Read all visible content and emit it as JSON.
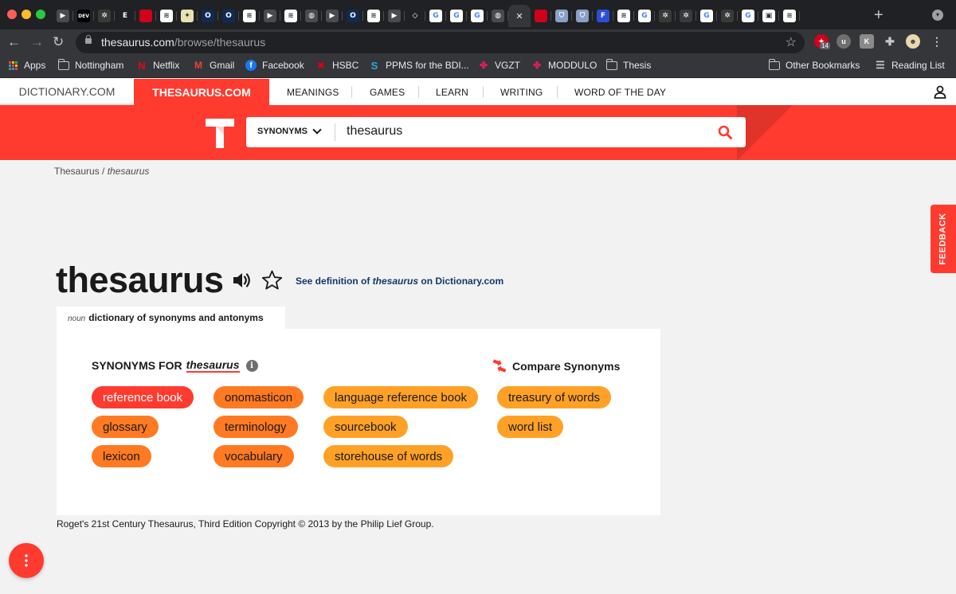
{
  "browser": {
    "tabs": [
      {
        "icon": "play-icon",
        "color": "#4a4b4f",
        "glyph": "▶"
      },
      {
        "icon": "dev-icon",
        "color": "#000000",
        "glyph": "DEV"
      },
      {
        "icon": "pinwheel-icon",
        "color": "#3a3a3a",
        "glyph": "✲"
      },
      {
        "icon": "e-icon",
        "color": "#202124",
        "glyph": "E"
      },
      {
        "icon": "red-square-icon",
        "color": "#d0021b",
        "glyph": ""
      },
      {
        "icon": "doc-icon",
        "color": "#ffffff",
        "glyph": "≋"
      },
      {
        "icon": "bird-icon",
        "color": "#e8e2b0",
        "glyph": "✦"
      },
      {
        "icon": "outlook-icon",
        "color": "#0f2b55",
        "glyph": "O"
      },
      {
        "icon": "outlook-icon",
        "color": "#0f2b55",
        "glyph": "O"
      },
      {
        "icon": "doc-icon",
        "color": "#ffffff",
        "glyph": "≋"
      },
      {
        "icon": "play-icon",
        "color": "#4a4b4f",
        "glyph": "▶"
      },
      {
        "icon": "doc-icon",
        "color": "#ffffff",
        "glyph": "≋"
      },
      {
        "icon": "globe-icon",
        "color": "#4a4b4f",
        "glyph": "◍"
      },
      {
        "icon": "play-icon",
        "color": "#4a4b4f",
        "glyph": "▶"
      },
      {
        "icon": "outlook-icon",
        "color": "#0f2b55",
        "glyph": "O"
      },
      {
        "icon": "doc-icon",
        "color": "#ffffff",
        "glyph": "≋"
      },
      {
        "icon": "play-icon",
        "color": "#4a4b4f",
        "glyph": "▶"
      },
      {
        "icon": "diamond-icon",
        "color": "#202124",
        "glyph": "◇"
      },
      {
        "icon": "google-icon",
        "color": "#ffffff",
        "glyph": "G"
      },
      {
        "icon": "google-icon",
        "color": "#ffffff",
        "glyph": "G"
      },
      {
        "icon": "google-icon",
        "color": "#ffffff",
        "glyph": "G"
      },
      {
        "icon": "globe-icon",
        "color": "#4a4b4f",
        "glyph": "◍"
      },
      {
        "icon": "close-icon",
        "color": "#35363a",
        "glyph": "✕",
        "active": true
      },
      {
        "icon": "red-square-icon",
        "color": "#d0021b",
        "glyph": ""
      },
      {
        "icon": "shield-icon",
        "color": "#8aa0c8",
        "glyph": "⛉"
      },
      {
        "icon": "shield-icon",
        "color": "#8aa0c8",
        "glyph": "⛉"
      },
      {
        "icon": "f-icon",
        "color": "#2b4fd8",
        "glyph": "F"
      },
      {
        "icon": "doc-icon",
        "color": "#ffffff",
        "glyph": "≋"
      },
      {
        "icon": "google-icon",
        "color": "#ffffff",
        "glyph": "G"
      },
      {
        "icon": "pinwheel-icon",
        "color": "#3a3a3a",
        "glyph": "✲"
      },
      {
        "icon": "pinwheel-icon",
        "color": "#3a3a3a",
        "glyph": "✲"
      },
      {
        "icon": "google-icon",
        "color": "#ffffff",
        "glyph": "G"
      },
      {
        "icon": "pinwheel-icon",
        "color": "#3a3a3a",
        "glyph": "✲"
      },
      {
        "icon": "google-icon",
        "color": "#ffffff",
        "glyph": "G"
      },
      {
        "icon": "lock-icon",
        "color": "#ffffff",
        "glyph": "▣"
      },
      {
        "icon": "doc-icon",
        "color": "#ffffff",
        "glyph": "≋"
      }
    ],
    "new_tab": "+",
    "url_host": "thesaurus.com",
    "url_path": "/browse/thesaurus",
    "extension_badge": "14",
    "bookmarks": [
      {
        "label": "Apps",
        "icon": "apps-icon"
      },
      {
        "label": "Nottingham",
        "icon": "folder-icon"
      },
      {
        "label": "Netflix",
        "icon": "netflix-icon"
      },
      {
        "label": "Gmail",
        "icon": "gmail-icon"
      },
      {
        "label": "Facebook",
        "icon": "facebook-icon"
      },
      {
        "label": "HSBC",
        "icon": "hsbc-icon"
      },
      {
        "label": "PPMS for the BDI...",
        "icon": "ppms-icon"
      },
      {
        "label": "VGZT",
        "icon": "slack-icon"
      },
      {
        "label": "MODDULO",
        "icon": "slack-icon"
      },
      {
        "label": "Thesis",
        "icon": "folder-icon"
      }
    ],
    "other_bookmarks": "Other Bookmarks",
    "reading_list": "Reading List"
  },
  "site": {
    "nav_dictionary": "DICTIONARY.COM",
    "nav_thesaurus": "THESAURUS.COM",
    "nav_links": [
      "MEANINGS",
      "GAMES",
      "LEARN",
      "WRITING",
      "WORD OF THE DAY"
    ],
    "search_mode": "SYNONYMS",
    "search_value": "thesaurus",
    "feedback": "FEEDBACK",
    "brand_color": "#ff3a2f"
  },
  "breadcrumb": {
    "root": "Thesaurus",
    "separator": " / ",
    "current": "thesaurus"
  },
  "entry": {
    "word": "thesaurus",
    "see_definition_prefix": "See definition of ",
    "see_definition_word": "thesaurus",
    "see_definition_suffix": " on Dictionary.com",
    "pos": "noun",
    "definition": "dictionary of synonyms and antonyms",
    "synonyms_for": "SYNONYMS FOR",
    "synonyms_word": "thesaurus",
    "info_glyph": "i",
    "compare": "Compare Synonyms",
    "synonyms": [
      {
        "text": "reference book",
        "relevance": "strongest"
      },
      {
        "text": "glossary",
        "relevance": "strong"
      },
      {
        "text": "lexicon",
        "relevance": "strong"
      },
      {
        "text": "onomasticon",
        "relevance": "strong"
      },
      {
        "text": "terminology",
        "relevance": "strong"
      },
      {
        "text": "vocabulary",
        "relevance": "strong"
      },
      {
        "text": "language reference book",
        "relevance": "medium"
      },
      {
        "text": "sourcebook",
        "relevance": "medium"
      },
      {
        "text": "storehouse of words",
        "relevance": "medium"
      },
      {
        "text": "treasury of words",
        "relevance": "medium"
      },
      {
        "text": "word list",
        "relevance": "medium"
      }
    ],
    "copyright": "Roget's 21st Century Thesaurus, Third Edition Copyright © 2013 by the Philip Lief Group."
  }
}
